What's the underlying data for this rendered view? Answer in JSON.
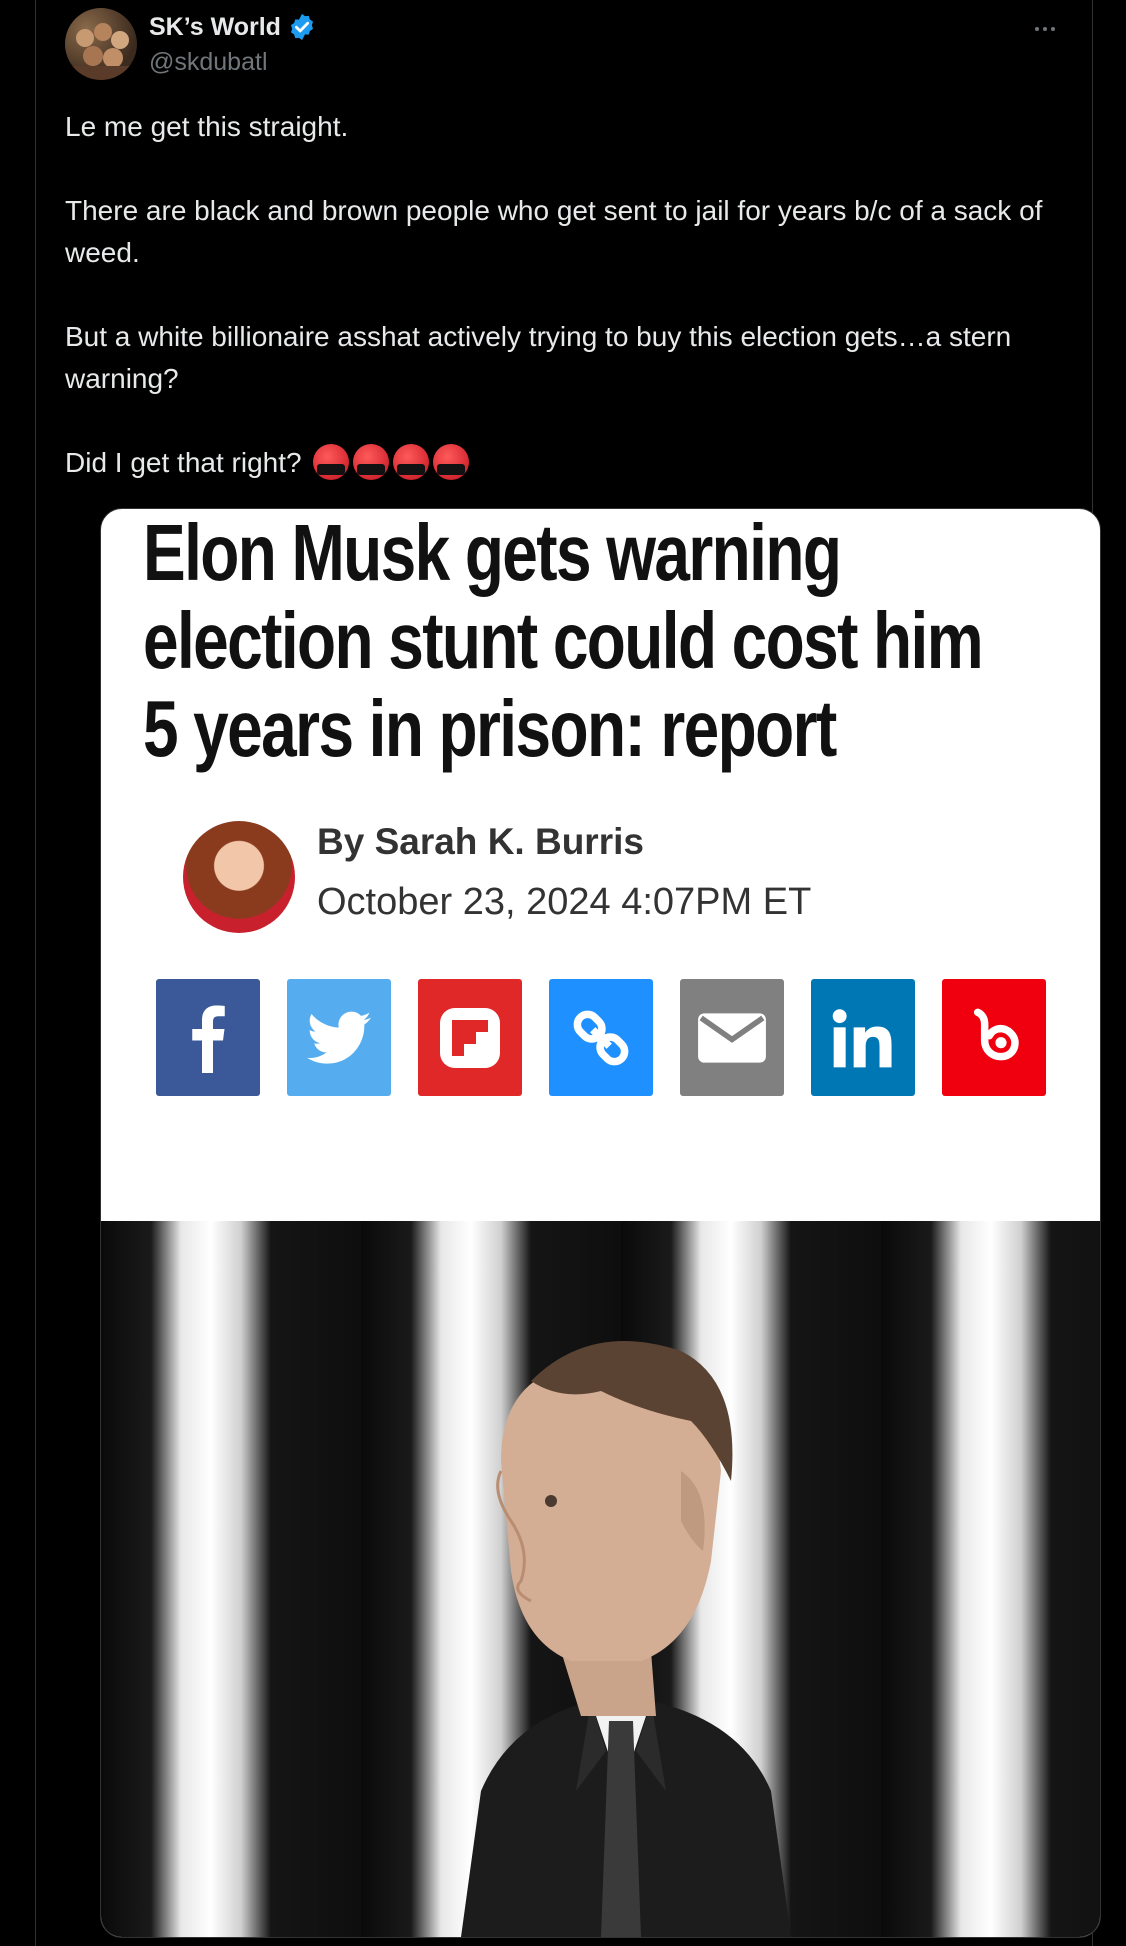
{
  "tweet": {
    "display_name": "SK’s World",
    "handle": "@skdubatl",
    "paragraphs": [
      "Le me get this straight.",
      "There are black and brown people who get sent to jail for years b/c of a sack of weed.",
      "But a white billionaire asshat actively trying to buy this election gets…a stern warning?",
      "Did I get that right?"
    ],
    "emojis": [
      "angry-face-with-symbols",
      "angry-face-with-symbols",
      "angry-face-with-symbols",
      "angry-face-with-symbols"
    ]
  },
  "card": {
    "headline": [
      "Elon Musk gets warning",
      "election stunt could cost him",
      "5 years in prison: report"
    ],
    "byline": "By Sarah K. Burris",
    "date": "October 23, 2024 4:07PM ET",
    "share_buttons": [
      {
        "name": "facebook",
        "color": "#3b5998"
      },
      {
        "name": "twitter",
        "color": "#55acee"
      },
      {
        "name": "flipboard",
        "color": "#e12828"
      },
      {
        "name": "copy-link",
        "color": "#1e90ff"
      },
      {
        "name": "email",
        "color": "#808080"
      },
      {
        "name": "linkedin",
        "color": "#0077b5"
      },
      {
        "name": "bluesky",
        "color": "#f0000f"
      }
    ]
  },
  "colors": {
    "background": "#000000",
    "text": "#e7e9ea",
    "muted": "#71767b",
    "verified": "#1d9bf0"
  }
}
